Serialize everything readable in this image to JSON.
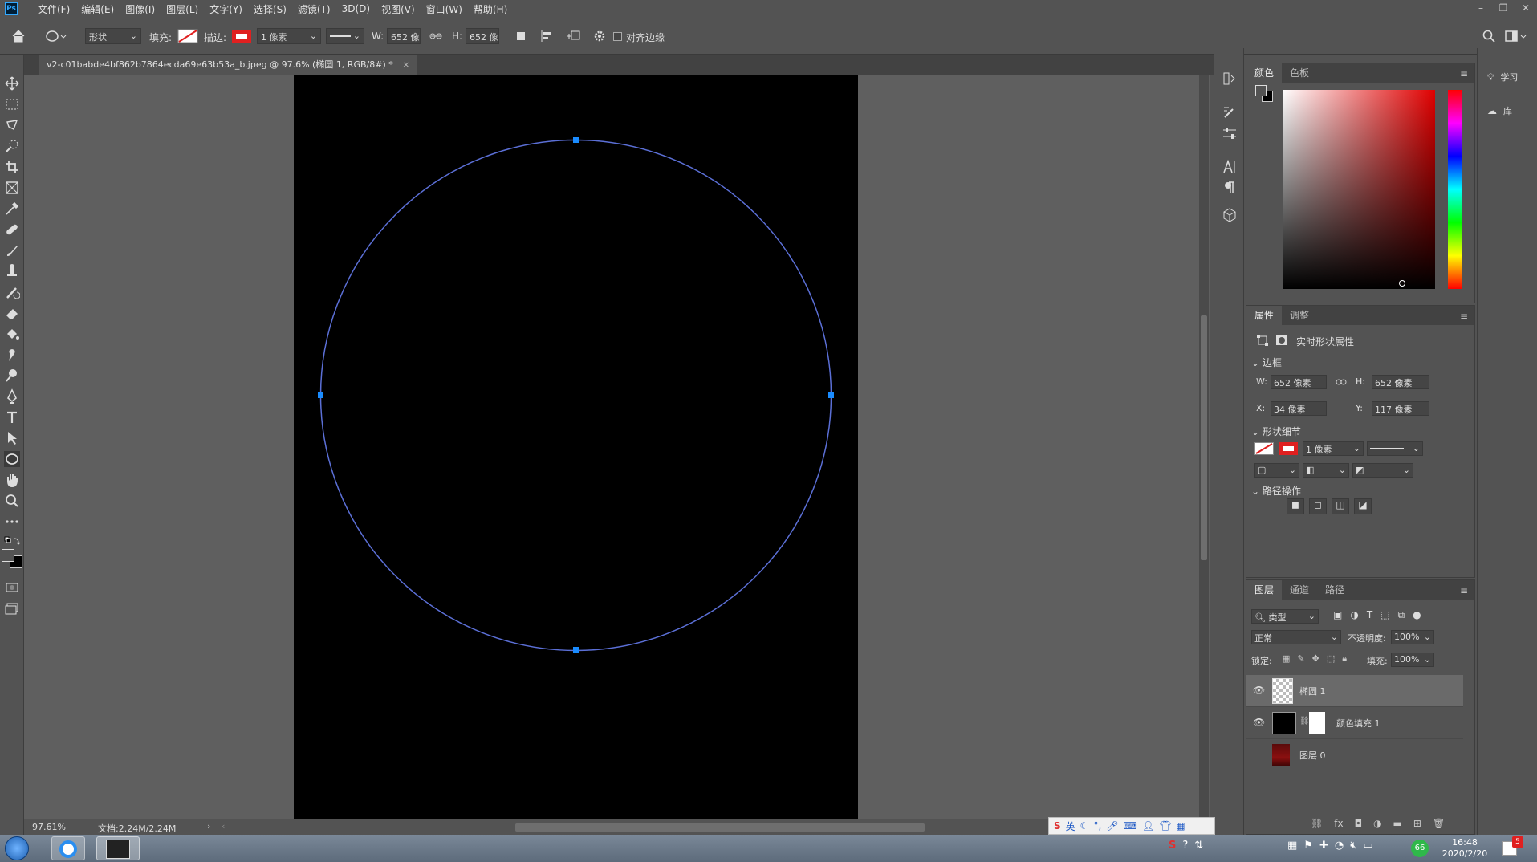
{
  "app": {
    "logo": "Ps"
  },
  "menu": [
    "文件(F)",
    "编辑(E)",
    "图像(I)",
    "图层(L)",
    "文字(Y)",
    "选择(S)",
    "滤镜(T)",
    "3D(D)",
    "视图(V)",
    "窗口(W)",
    "帮助(H)"
  ],
  "options": {
    "mode": "形状",
    "fill_label": "填充:",
    "stroke_label": "描边:",
    "stroke_width": "1 像素",
    "w_label": "W:",
    "w_value": "652 像",
    "h_label": "H:",
    "h_value": "652 像",
    "align_edges": "对齐边缘"
  },
  "document": {
    "tab_title": "v2-c01babde4bf862b7864ecda69e63b53a_b.jpeg @ 97.6% (椭圆 1, RGB/8#) *",
    "close": "×"
  },
  "status": {
    "zoom": "97.61%",
    "doc_size": "文档:2.24M/2.24M"
  },
  "color_panel": {
    "tabs": [
      "颜色",
      "色板"
    ]
  },
  "properties": {
    "tabs": [
      "属性",
      "调整"
    ],
    "title": "实时形状属性",
    "bounds_section": "边框",
    "w_label": "W:",
    "w": "652 像素",
    "h_label": "H:",
    "h": "652 像素",
    "x_label": "X:",
    "x": "34 像素",
    "y_label": "Y:",
    "y": "117 像素",
    "shape_section": "形状细节",
    "stroke_width": "1 像素",
    "path_section": "路径操作"
  },
  "layers": {
    "tabs": [
      "图层",
      "通道",
      "路径"
    ],
    "filter": "类型",
    "blend": "正常",
    "opacity_label": "不透明度:",
    "opacity": "100%",
    "lock_label": "锁定:",
    "fill_label": "填充:",
    "fill": "100%",
    "items": [
      {
        "name": "椭圆 1",
        "selected": true,
        "visible": true
      },
      {
        "name": "颜色填充 1",
        "selected": false,
        "visible": true
      },
      {
        "name": "图层 0",
        "selected": false,
        "visible": false
      }
    ]
  },
  "far_right": {
    "learn": "学习",
    "library": "库"
  },
  "ime": {
    "lang": "英"
  },
  "taskbar": {
    "time": "16:48",
    "date": "2020/2/20",
    "badge": "5",
    "green_badge": "66"
  },
  "colors": {
    "accent": "#1473e6",
    "path": "#5b6fd6",
    "anchor": "#1a8cff",
    "stroke_swatch": "#e02020"
  }
}
